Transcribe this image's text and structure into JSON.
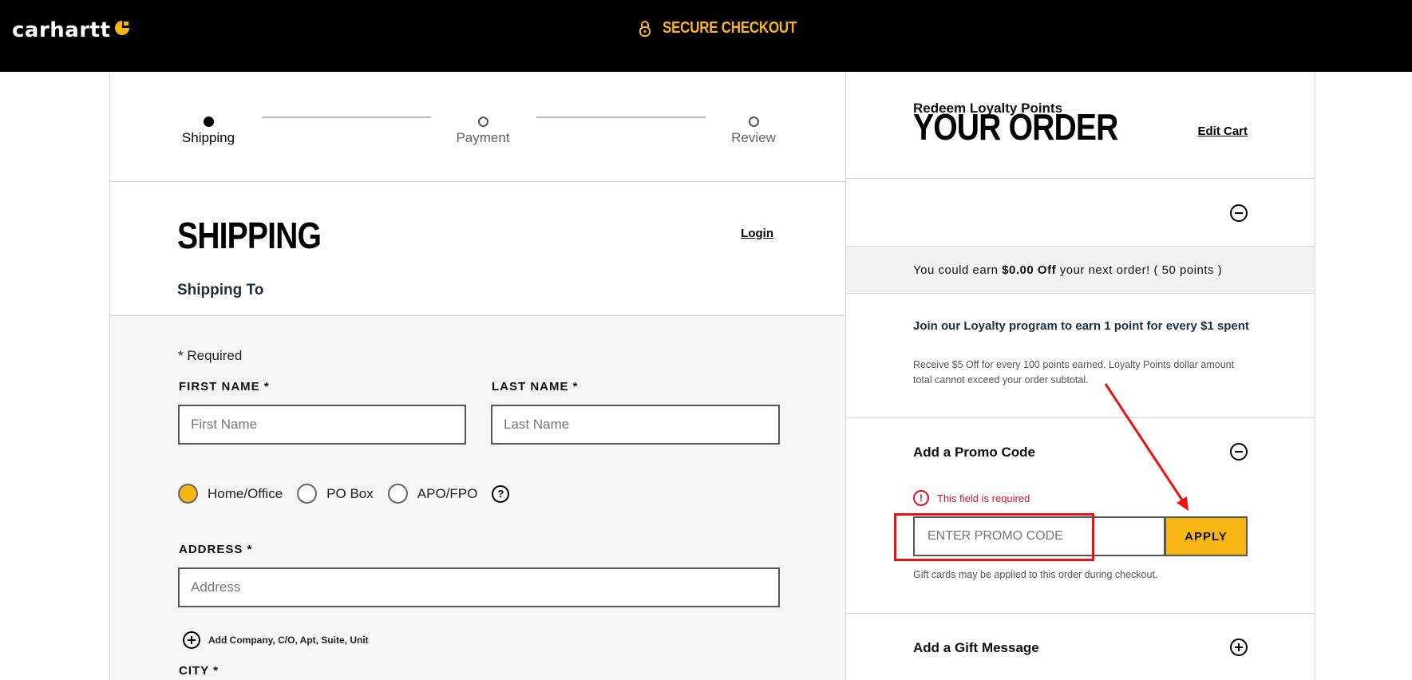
{
  "header": {
    "brand": "carhartt",
    "secure_label": "SECURE CHECKOUT",
    "colors": {
      "bar": "#000000",
      "accent": "#f7b614"
    }
  },
  "stepper": {
    "steps": [
      {
        "label": "Shipping",
        "active": true
      },
      {
        "label": "Payment",
        "active": false
      },
      {
        "label": "Review",
        "active": false
      }
    ]
  },
  "shipping": {
    "title": "SHIPPING",
    "login": "Login",
    "subtitle": "Shipping To",
    "required_note": "* Required",
    "first_name": {
      "label": "FIRST NAME *",
      "placeholder": "First Name"
    },
    "last_name": {
      "label": "LAST NAME *",
      "placeholder": "Last Name"
    },
    "address_types": [
      "Home/Office",
      "PO Box",
      "APO/FPO"
    ],
    "help": "?",
    "address": {
      "label": "ADDRESS *",
      "placeholder": "Address"
    },
    "add_company": "Add Company, C/O, Apt, Suite, Unit",
    "city": {
      "label": "CITY *"
    }
  },
  "order": {
    "title": "YOUR ORDER",
    "edit_cart": "Edit Cart",
    "loyalty": {
      "title": "Redeem Loyalty Points",
      "earn_prefix": "You could earn ",
      "earn_amount": "$0.00 Off",
      "earn_suffix": " your next order! ( 50 points )",
      "join_title": "Join our Loyalty program to earn 1 point for every $1 spent",
      "join_desc": "Receive $5 Off for every 100 points earned. Loyalty Points dollar amount total cannot exceed your order subtotal."
    },
    "promo": {
      "title": "Add a Promo Code",
      "error_icon": "!",
      "error": "This field is required",
      "placeholder": "ENTER PROMO CODE",
      "apply": "APPLY",
      "note": "Gift cards may be applied to this order during checkout."
    },
    "gift_message": {
      "title": "Add a Gift Message"
    }
  },
  "annotation_color": "#ee1010"
}
